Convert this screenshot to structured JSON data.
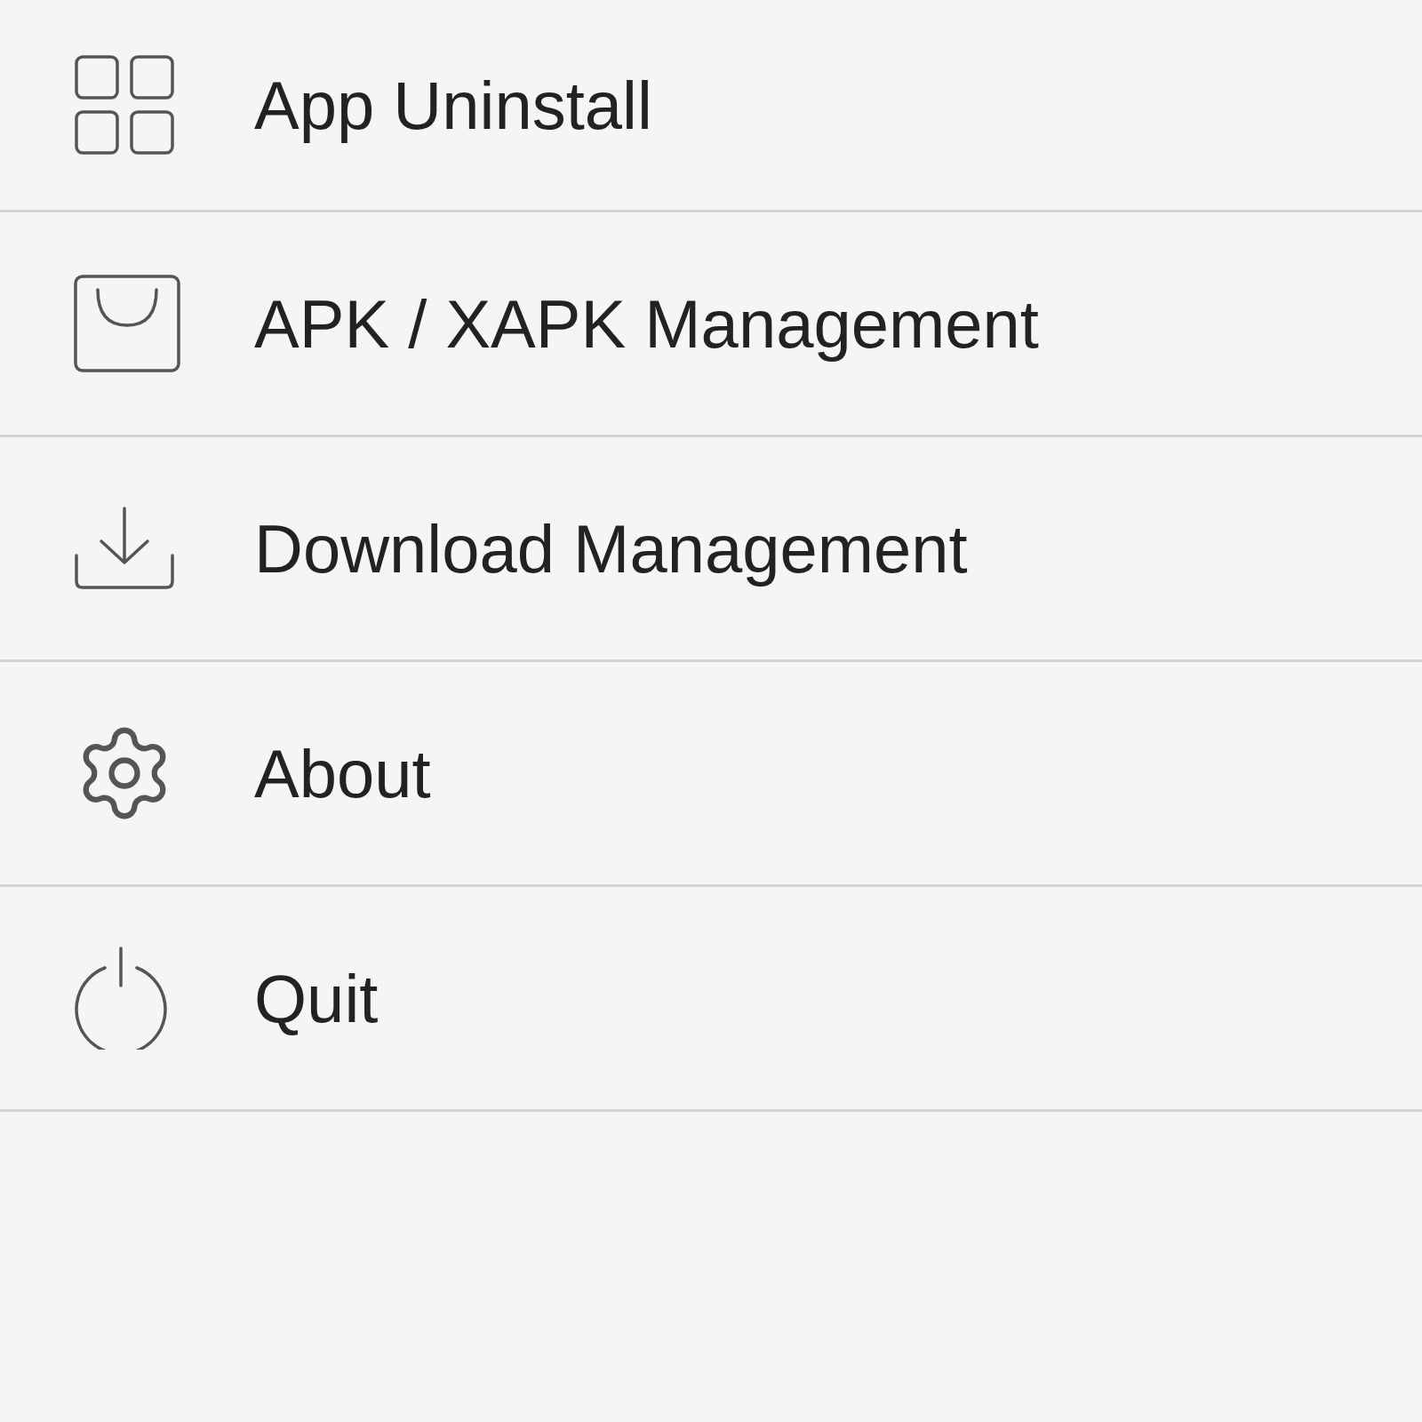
{
  "menu": {
    "items": [
      {
        "kind": "apps",
        "label": "App Uninstall"
      },
      {
        "kind": "bag",
        "label": "APK / XAPK Management"
      },
      {
        "kind": "download",
        "label": "Download Management"
      },
      {
        "kind": "gear",
        "label": "About"
      },
      {
        "kind": "power",
        "label": "Quit"
      }
    ]
  }
}
